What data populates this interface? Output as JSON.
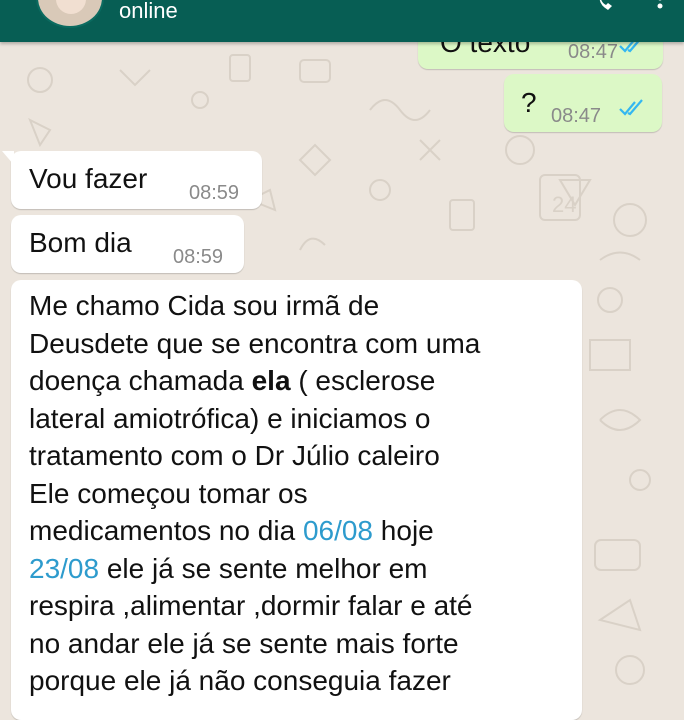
{
  "header": {
    "status": "online"
  },
  "messages": [
    {
      "id": "out1",
      "direction": "out",
      "text": "O texto",
      "time": "08:47"
    },
    {
      "id": "out2",
      "direction": "out",
      "text": "?",
      "time": "08:47"
    },
    {
      "id": "in1",
      "direction": "in",
      "text": "Vou fazer",
      "time": "08:59"
    },
    {
      "id": "in2",
      "direction": "in",
      "text": "Bom dia",
      "time": "08:59"
    }
  ],
  "long_message": {
    "direction": "in",
    "lines": [
      "Me chamo Cida sou irmã de",
      "Deusdete que se encontra com uma",
      {
        "pre": "doença chamada ",
        "bold": "ela",
        "post": " ( esclerose"
      },
      "lateral amiotrófica) e iniciamos o",
      "tratamento com o Dr Júlio caleiro",
      "Ele começou tomar os",
      {
        "pre": "medicamentos no dia ",
        "date": "06/08",
        "post": " hoje"
      },
      {
        "date": "23/08",
        "post": " ele já se sente melhor em"
      },
      "respira ,alimentar ,dormir falar e até",
      "no andar ele já se sente mais forte",
      "porque ele já não conseguia fazer"
    ]
  },
  "colors": {
    "header": "#075E54",
    "outgoing_bubble": "#DCF8C6",
    "incoming_bubble": "#FFFFFF",
    "read_ticks": "#34B7F1",
    "date_link": "#2D9BCD",
    "wallpaper": "#ECE5DD"
  }
}
